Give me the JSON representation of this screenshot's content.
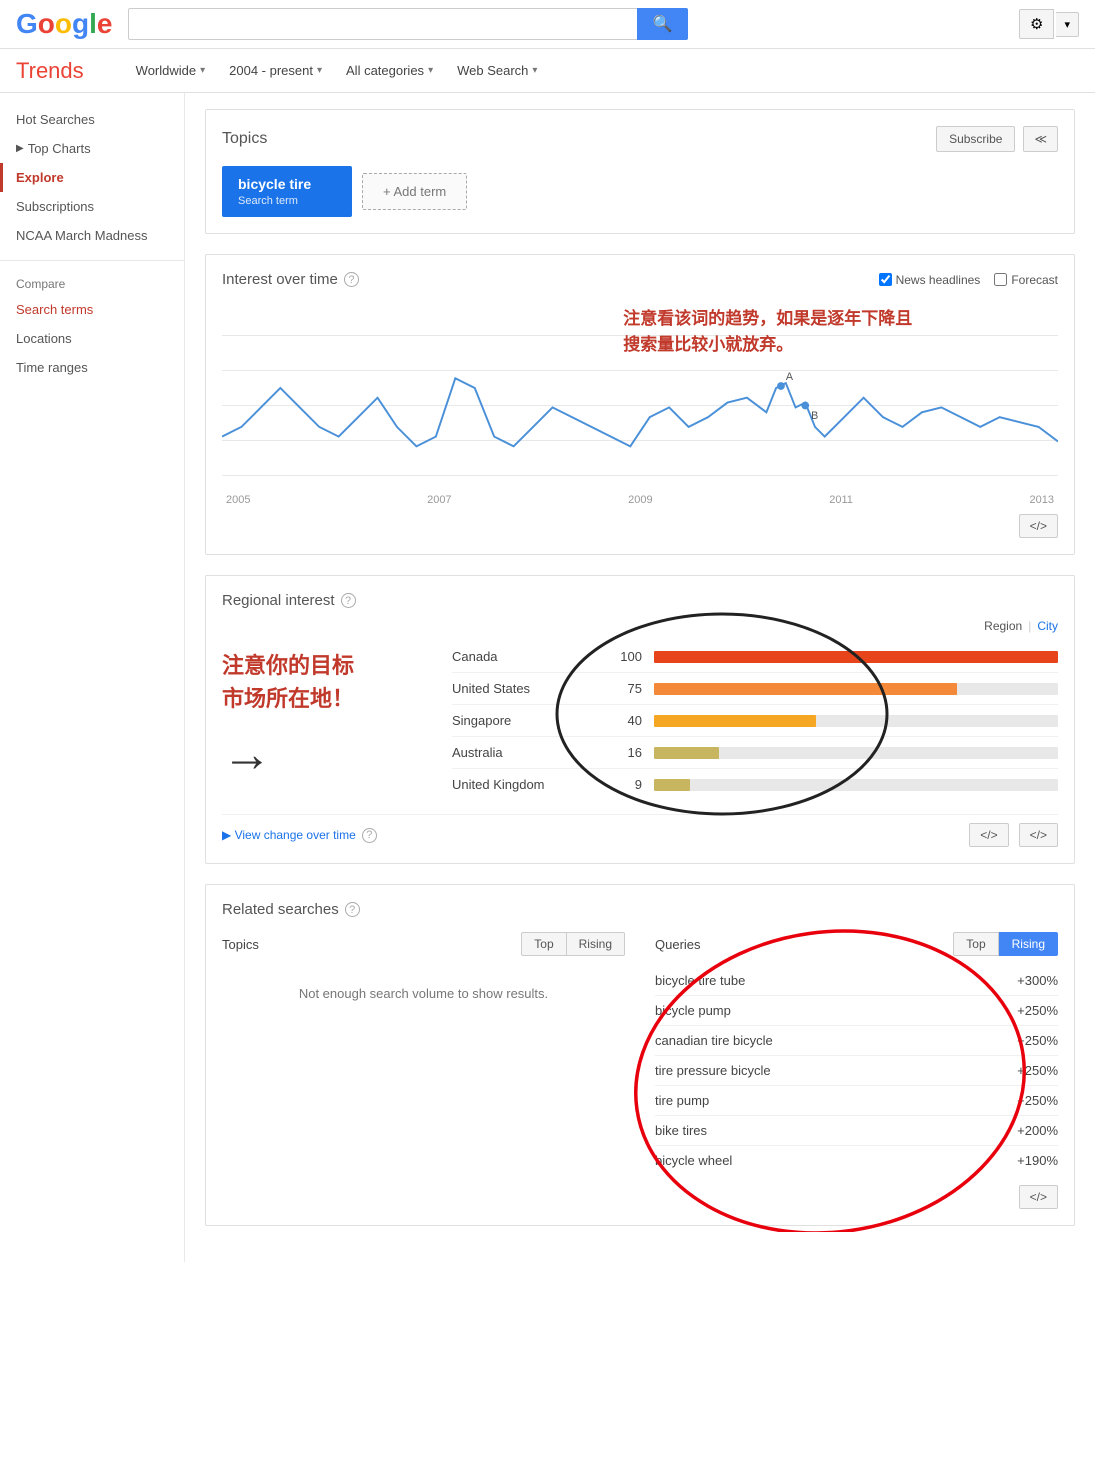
{
  "header": {
    "logo_letters": [
      "G",
      "o",
      "o",
      "g",
      "l",
      "e"
    ],
    "search_placeholder": "",
    "search_btn_icon": "🔍",
    "gear_icon": "⚙",
    "arrow_icon": "▾"
  },
  "navbar": {
    "trends_label": "Trends",
    "dropdowns": [
      {
        "label": "Worldwide",
        "key": "worldwide"
      },
      {
        "label": "2004 - present",
        "key": "date"
      },
      {
        "label": "All categories",
        "key": "categories"
      },
      {
        "label": "Web Search",
        "key": "search_type"
      }
    ]
  },
  "sidebar": {
    "items": [
      {
        "label": "Hot Searches",
        "active": false,
        "key": "hot-searches"
      },
      {
        "label": "Top Charts",
        "active": false,
        "key": "top-charts",
        "arrow": true
      },
      {
        "label": "Explore",
        "active": true,
        "key": "explore"
      },
      {
        "label": "Subscriptions",
        "active": false,
        "key": "subscriptions"
      },
      {
        "label": "NCAA March Madness",
        "active": false,
        "key": "ncaa"
      }
    ],
    "compare_label": "Compare",
    "compare_items": [
      {
        "label": "Search terms",
        "active": true,
        "key": "search-terms"
      },
      {
        "label": "Locations",
        "active": false,
        "key": "locations"
      },
      {
        "label": "Time ranges",
        "active": false,
        "key": "time-ranges"
      }
    ]
  },
  "topics": {
    "title": "Topics",
    "subscribe_label": "Subscribe",
    "share_icon": "≪",
    "chip": {
      "label": "bicycle tire",
      "type": "Search term"
    },
    "add_term_label": "+ Add term"
  },
  "interest_over_time": {
    "title": "Interest over time",
    "news_headlines_label": "News headlines",
    "forecast_label": "Forecast",
    "annotation": "注意看该词的趋势，如果是逐年下降且\n搜索量比较小就放弃。",
    "x_labels": [
      "2005",
      "2007",
      "2009",
      "2011",
      "2013"
    ],
    "embed_icon": "</>",
    "points_A": "A",
    "points_B": "B"
  },
  "regional_interest": {
    "title": "Regional interest",
    "region_label": "Region",
    "city_label": "City",
    "annotation_text": "注意你的目标\n市场所在地！",
    "regions": [
      {
        "name": "Canada",
        "score": 100,
        "color": "#E8441B"
      },
      {
        "name": "United States",
        "score": 75,
        "color": "#F4893A"
      },
      {
        "name": "Singapore",
        "score": 40,
        "color": "#F5A623"
      },
      {
        "name": "Australia",
        "score": 16,
        "color": "#C8B560"
      },
      {
        "name": "United Kingdom",
        "score": 9,
        "color": "#C8B560"
      }
    ],
    "view_change_label": "▶ View change over time",
    "embed_icon": "</>",
    "help_icon": "?"
  },
  "related_searches": {
    "title": "Related searches",
    "help_icon": "?",
    "topics": {
      "label": "Topics",
      "top_label": "Top",
      "rising_label": "Rising",
      "no_data": "Not enough search volume to show results."
    },
    "queries": {
      "label": "Queries",
      "top_label": "Top",
      "rising_label": "Rising",
      "active": "Rising",
      "items": [
        {
          "query": "bicycle tire tube",
          "pct": "+300%"
        },
        {
          "query": "bicycle pump",
          "pct": "+250%"
        },
        {
          "query": "canadian tire bicycle",
          "pct": "+250%"
        },
        {
          "query": "tire pressure bicycle",
          "pct": "+250%"
        },
        {
          "query": "tire pump",
          "pct": "+250%"
        },
        {
          "query": "bike tires",
          "pct": "+200%"
        },
        {
          "query": "bicycle wheel",
          "pct": "+190%"
        }
      ]
    }
  }
}
